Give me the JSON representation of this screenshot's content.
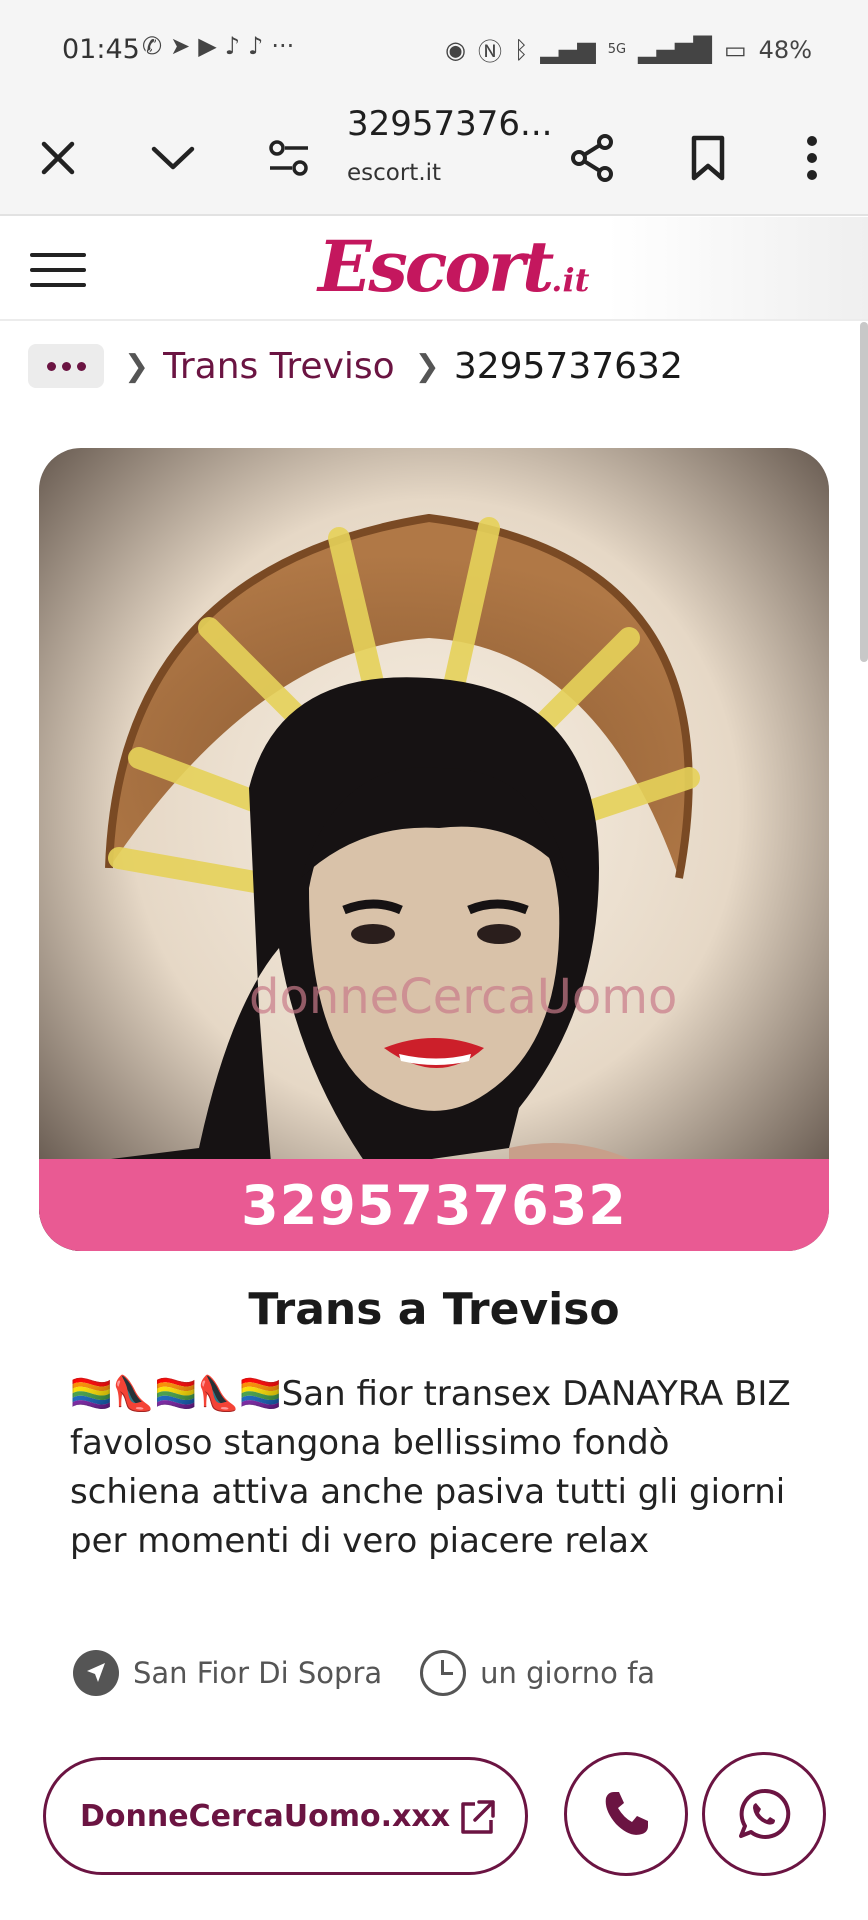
{
  "status_bar": {
    "time": "01:45",
    "battery": "48%",
    "network": "5G",
    "app_icons": [
      "whatsapp-icon",
      "telegram-icon",
      "youtube-icon",
      "tiktok-icon",
      "tiktok-icon",
      "more-icon"
    ],
    "more": "···"
  },
  "browser": {
    "page_title": "32957376...",
    "host": "escort.it"
  },
  "site": {
    "logo_main": "Escort",
    "logo_tld": ".it",
    "brand_color": "#c4175e",
    "accent_color": "#6b1442"
  },
  "breadcrumb": {
    "items": [
      {
        "label": "Trans Treviso"
      },
      {
        "label": "3295737632"
      }
    ]
  },
  "listing": {
    "phone_banner": "3295737632",
    "banner_color": "#e95a93",
    "photo_watermark": "donneCercaUomo",
    "title": "Trans a Treviso",
    "description": "🏳️‍🌈👠🏳️‍🌈👠🏳️‍🌈San fior transex DANAYRA BIZ favoloso stangona bellissimo fondò schiena attiva anche pasiva tutti gli giorni per momenti di vero piacere relax",
    "location": "San Fior Di Sopra",
    "posted": "un giorno fa"
  },
  "actions": {
    "site_link": "DonneCercaUomo.xxx"
  }
}
